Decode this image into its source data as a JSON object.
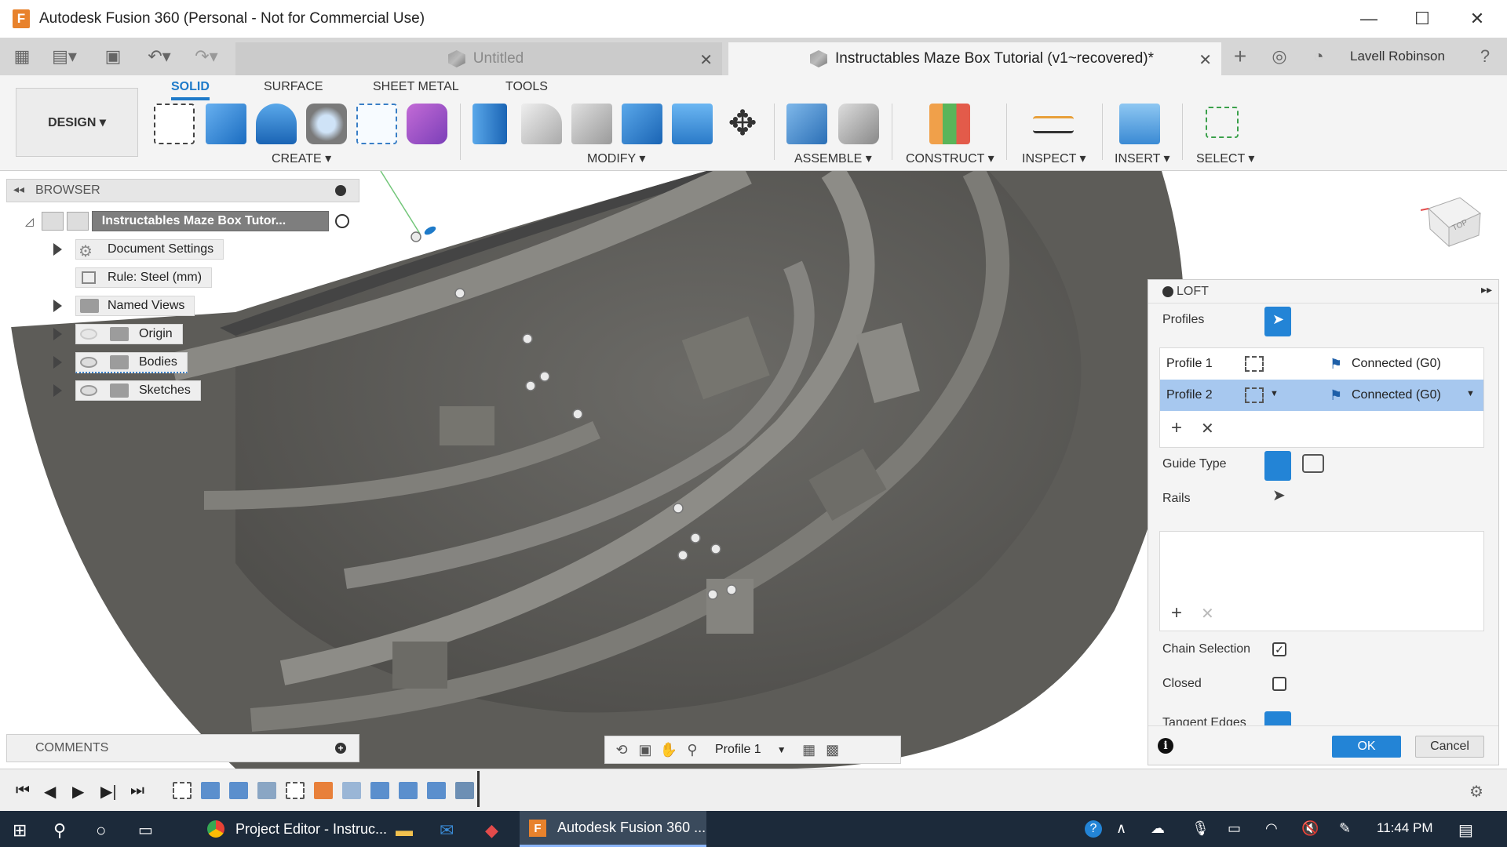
{
  "window": {
    "title": "Autodesk Fusion 360 (Personal - Not for Commercial Use)",
    "logo_letter": "F",
    "minimize": "—",
    "maximize": "☐",
    "close": "✕"
  },
  "tabs": [
    {
      "label": "Untitled",
      "close": "✕"
    },
    {
      "label": "Instructables Maze Box Tutorial (v1~recovered)*",
      "close": "✕"
    }
  ],
  "user": {
    "name": "Lavell Robinson"
  },
  "toolbar": {
    "workspace": "DESIGN ▾",
    "ribbon_tabs": [
      "SOLID",
      "SURFACE",
      "SHEET METAL",
      "TOOLS"
    ],
    "groups": [
      "CREATE ▾",
      "MODIFY ▾",
      "ASSEMBLE ▾",
      "CONSTRUCT ▾",
      "INSPECT ▾",
      "INSERT ▾",
      "SELECT ▾"
    ]
  },
  "browser": {
    "title": "BROWSER",
    "root": "Instructables Maze Box Tutor...",
    "items": [
      "Document Settings",
      "Rule: Steel (mm)",
      "Named Views",
      "Origin",
      "Bodies",
      "Sketches"
    ]
  },
  "comments": {
    "title": "COMMENTS"
  },
  "navbar": {
    "profile": "Profile 1"
  },
  "viewcube": {
    "label": "TOP"
  },
  "loft": {
    "title": "LOFT",
    "profiles_label": "Profiles",
    "profiles": [
      {
        "name": "Profile 1",
        "continuity": "Connected (G0)"
      },
      {
        "name": "Profile 2",
        "continuity": "Connected (G0)"
      }
    ],
    "guide_type_label": "Guide Type",
    "rails_label": "Rails",
    "chain_selection_label": "Chain Selection",
    "chain_selection": true,
    "closed_label": "Closed",
    "closed": false,
    "tangent_edges_label": "Tangent Edges",
    "ok": "OK",
    "cancel": "Cancel"
  },
  "taskbar": {
    "items": [
      "Project Editor - Instruc...",
      "Autodesk Fusion 360 ..."
    ],
    "time": "11:44 PM"
  },
  "colors": {
    "accent": "#1e7ac9",
    "selection": "#a7c8ef",
    "taskbar": "#1c2a3a",
    "model": "#6b6a66"
  }
}
